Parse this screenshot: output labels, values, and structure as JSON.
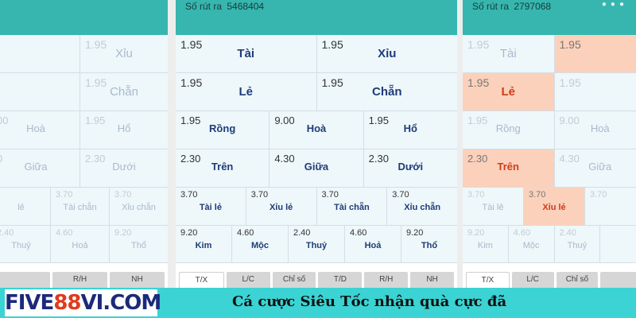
{
  "panels": [
    {
      "draw_id": null,
      "rows": [
        [
          {
            "odds": "",
            "label": "",
            "hl": false
          },
          {
            "odds": "1.95",
            "label": "Xỉu",
            "hl": false
          }
        ],
        [
          {
            "odds": "",
            "label": "",
            "hl": false
          },
          {
            "odds": "1.95",
            "label": "Chẵn",
            "hl": false
          }
        ],
        [
          {
            "odds": "00",
            "label": "Hoà",
            "hl": false
          },
          {
            "odds": "1.95",
            "label": "Hổ",
            "hl": false
          }
        ],
        [
          {
            "odds": "0",
            "label": "Giữa",
            "hl": false
          },
          {
            "odds": "2.30",
            "label": "Dưới",
            "hl": false
          }
        ],
        [
          {
            "odds": "",
            "label": "lẻ",
            "hl": false
          },
          {
            "odds": "3.70",
            "label": "Tài chẵn",
            "hl": false
          },
          {
            "odds": "3.70",
            "label": "Xỉu chẵn",
            "hl": false
          }
        ],
        [
          {
            "odds": "2.40",
            "label": "Thuỷ",
            "hl": false
          },
          {
            "odds": "4.60",
            "label": "Hoả",
            "hl": false
          },
          {
            "odds": "9.20",
            "label": "Thổ",
            "hl": false
          }
        ]
      ],
      "tabs": [
        {
          "label": "",
          "active": false
        },
        {
          "label": "R/H",
          "active": false
        },
        {
          "label": "NH",
          "active": false
        }
      ]
    },
    {
      "draw_id": {
        "label": "Số rút ra",
        "value": "5468404"
      },
      "rows": [
        [
          {
            "odds": "1.95",
            "label": "Tài",
            "hl": false
          },
          {
            "odds": "1.95",
            "label": "Xỉu",
            "hl": false
          }
        ],
        [
          {
            "odds": "1.95",
            "label": "Lẻ",
            "hl": false
          },
          {
            "odds": "1.95",
            "label": "Chẵn",
            "hl": false
          }
        ],
        [
          {
            "odds": "1.95",
            "label": "Rồng",
            "hl": false
          },
          {
            "odds": "9.00",
            "label": "Hoà",
            "hl": false
          },
          {
            "odds": "1.95",
            "label": "Hổ",
            "hl": false
          }
        ],
        [
          {
            "odds": "2.30",
            "label": "Trên",
            "hl": false
          },
          {
            "odds": "4.30",
            "label": "Giữa",
            "hl": false
          },
          {
            "odds": "2.30",
            "label": "Dưới",
            "hl": false
          }
        ],
        [
          {
            "odds": "3.70",
            "label": "Tài lẻ",
            "hl": false
          },
          {
            "odds": "3.70",
            "label": "Xỉu lẻ",
            "hl": false
          },
          {
            "odds": "3.70",
            "label": "Tài chẵn",
            "hl": false
          },
          {
            "odds": "3.70",
            "label": "Xỉu chẵn",
            "hl": false
          }
        ],
        [
          {
            "odds": "9.20",
            "label": "Kim",
            "hl": false
          },
          {
            "odds": "4.60",
            "label": "Mộc",
            "hl": false
          },
          {
            "odds": "2.40",
            "label": "Thuỷ",
            "hl": false
          },
          {
            "odds": "4.60",
            "label": "Hoả",
            "hl": false
          },
          {
            "odds": "9.20",
            "label": "Thổ",
            "hl": false
          }
        ]
      ],
      "tabs": [
        {
          "label": "T/X",
          "active": true
        },
        {
          "label": "L/C",
          "active": false
        },
        {
          "label": "Chỉ số",
          "active": false
        },
        {
          "label": "T/D",
          "active": false
        },
        {
          "label": "R/H",
          "active": false
        },
        {
          "label": "NH",
          "active": false
        }
      ]
    },
    {
      "draw_id": {
        "label": "Số rút ra",
        "value": "2797068"
      },
      "rows": [
        [
          {
            "odds": "1.95",
            "label": "Tài",
            "hl": false
          },
          {
            "odds": "1.95",
            "label": "",
            "hl": true
          }
        ],
        [
          {
            "odds": "1.95",
            "label": "Lẻ",
            "hl": true
          },
          {
            "odds": "1.95",
            "label": "",
            "hl": false
          }
        ],
        [
          {
            "odds": "1.95",
            "label": "Rồng",
            "hl": false
          },
          {
            "odds": "9.00",
            "label": "Hoà",
            "hl": false
          }
        ],
        [
          {
            "odds": "2.30",
            "label": "Trên",
            "hl": true
          },
          {
            "odds": "4.30",
            "label": "Giữa",
            "hl": false
          }
        ],
        [
          {
            "odds": "3.70",
            "label": "Tài lẻ",
            "hl": false
          },
          {
            "odds": "3.70",
            "label": "Xỉu lẻ",
            "hl": true
          },
          {
            "odds": "3.70",
            "label": "",
            "hl": false
          }
        ],
        [
          {
            "odds": "9.20",
            "label": "Kim",
            "hl": false
          },
          {
            "odds": "4.60",
            "label": "Mộc",
            "hl": false
          },
          {
            "odds": "2.40",
            "label": "Thuỷ",
            "hl": false
          },
          {
            "odds": "",
            "label": "",
            "hl": false
          }
        ]
      ],
      "tabs": [
        {
          "label": "T/X",
          "active": true
        },
        {
          "label": "L/C",
          "active": false
        },
        {
          "label": "Chỉ số",
          "active": false
        },
        {
          "label": "",
          "active": false
        }
      ]
    }
  ],
  "banner": {
    "logo": {
      "part1": "FIVE",
      "part2": "88",
      "part3": "VI.COM"
    },
    "slogan": "Cá cược Siêu Tốc nhận quà cực đã"
  },
  "colors": {
    "header": "#36b6ae",
    "highlight": "#fbd1bb",
    "banner": "#3bd3d3",
    "label_blue": "#1e3c78",
    "label_red": "#d03a1a"
  }
}
